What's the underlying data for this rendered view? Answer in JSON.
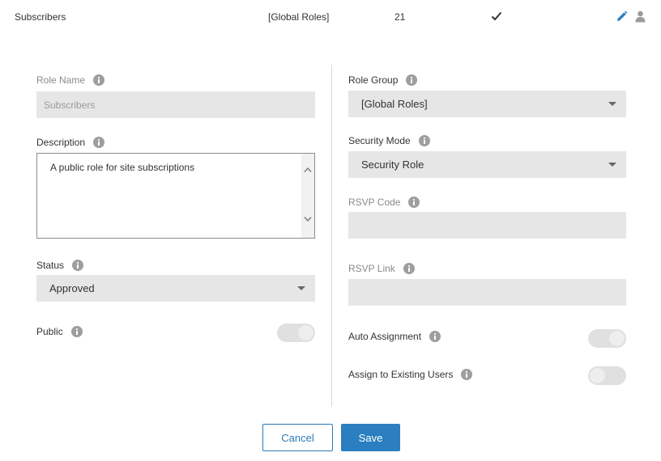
{
  "row": {
    "name": "Subscribers",
    "group": "[Global Roles]",
    "count": "21"
  },
  "colors": {
    "accent": "#2b7fc0",
    "field_bg": "#e6e6e6",
    "muted_text": "#8a8a8a"
  },
  "icons": {
    "check": "check-icon",
    "edit": "pencil-icon",
    "user": "user-icon",
    "info": "info-icon"
  },
  "form": {
    "role_name": {
      "label": "Role Name",
      "value": "Subscribers"
    },
    "description": {
      "label": "Description",
      "value": "A public role for site subscriptions"
    },
    "status": {
      "label": "Status",
      "value": "Approved"
    },
    "public": {
      "label": "Public"
    },
    "role_group": {
      "label": "Role Group",
      "value": "[Global Roles]"
    },
    "security_mode": {
      "label": "Security Mode",
      "value": "Security Role"
    },
    "rsvp_code": {
      "label": "RSVP Code",
      "value": ""
    },
    "rsvp_link": {
      "label": "RSVP Link",
      "value": ""
    },
    "auto_assignment": {
      "label": "Auto Assignment"
    },
    "assign_existing": {
      "label": "Assign to Existing Users"
    }
  },
  "buttons": {
    "cancel": "Cancel",
    "save": "Save"
  }
}
